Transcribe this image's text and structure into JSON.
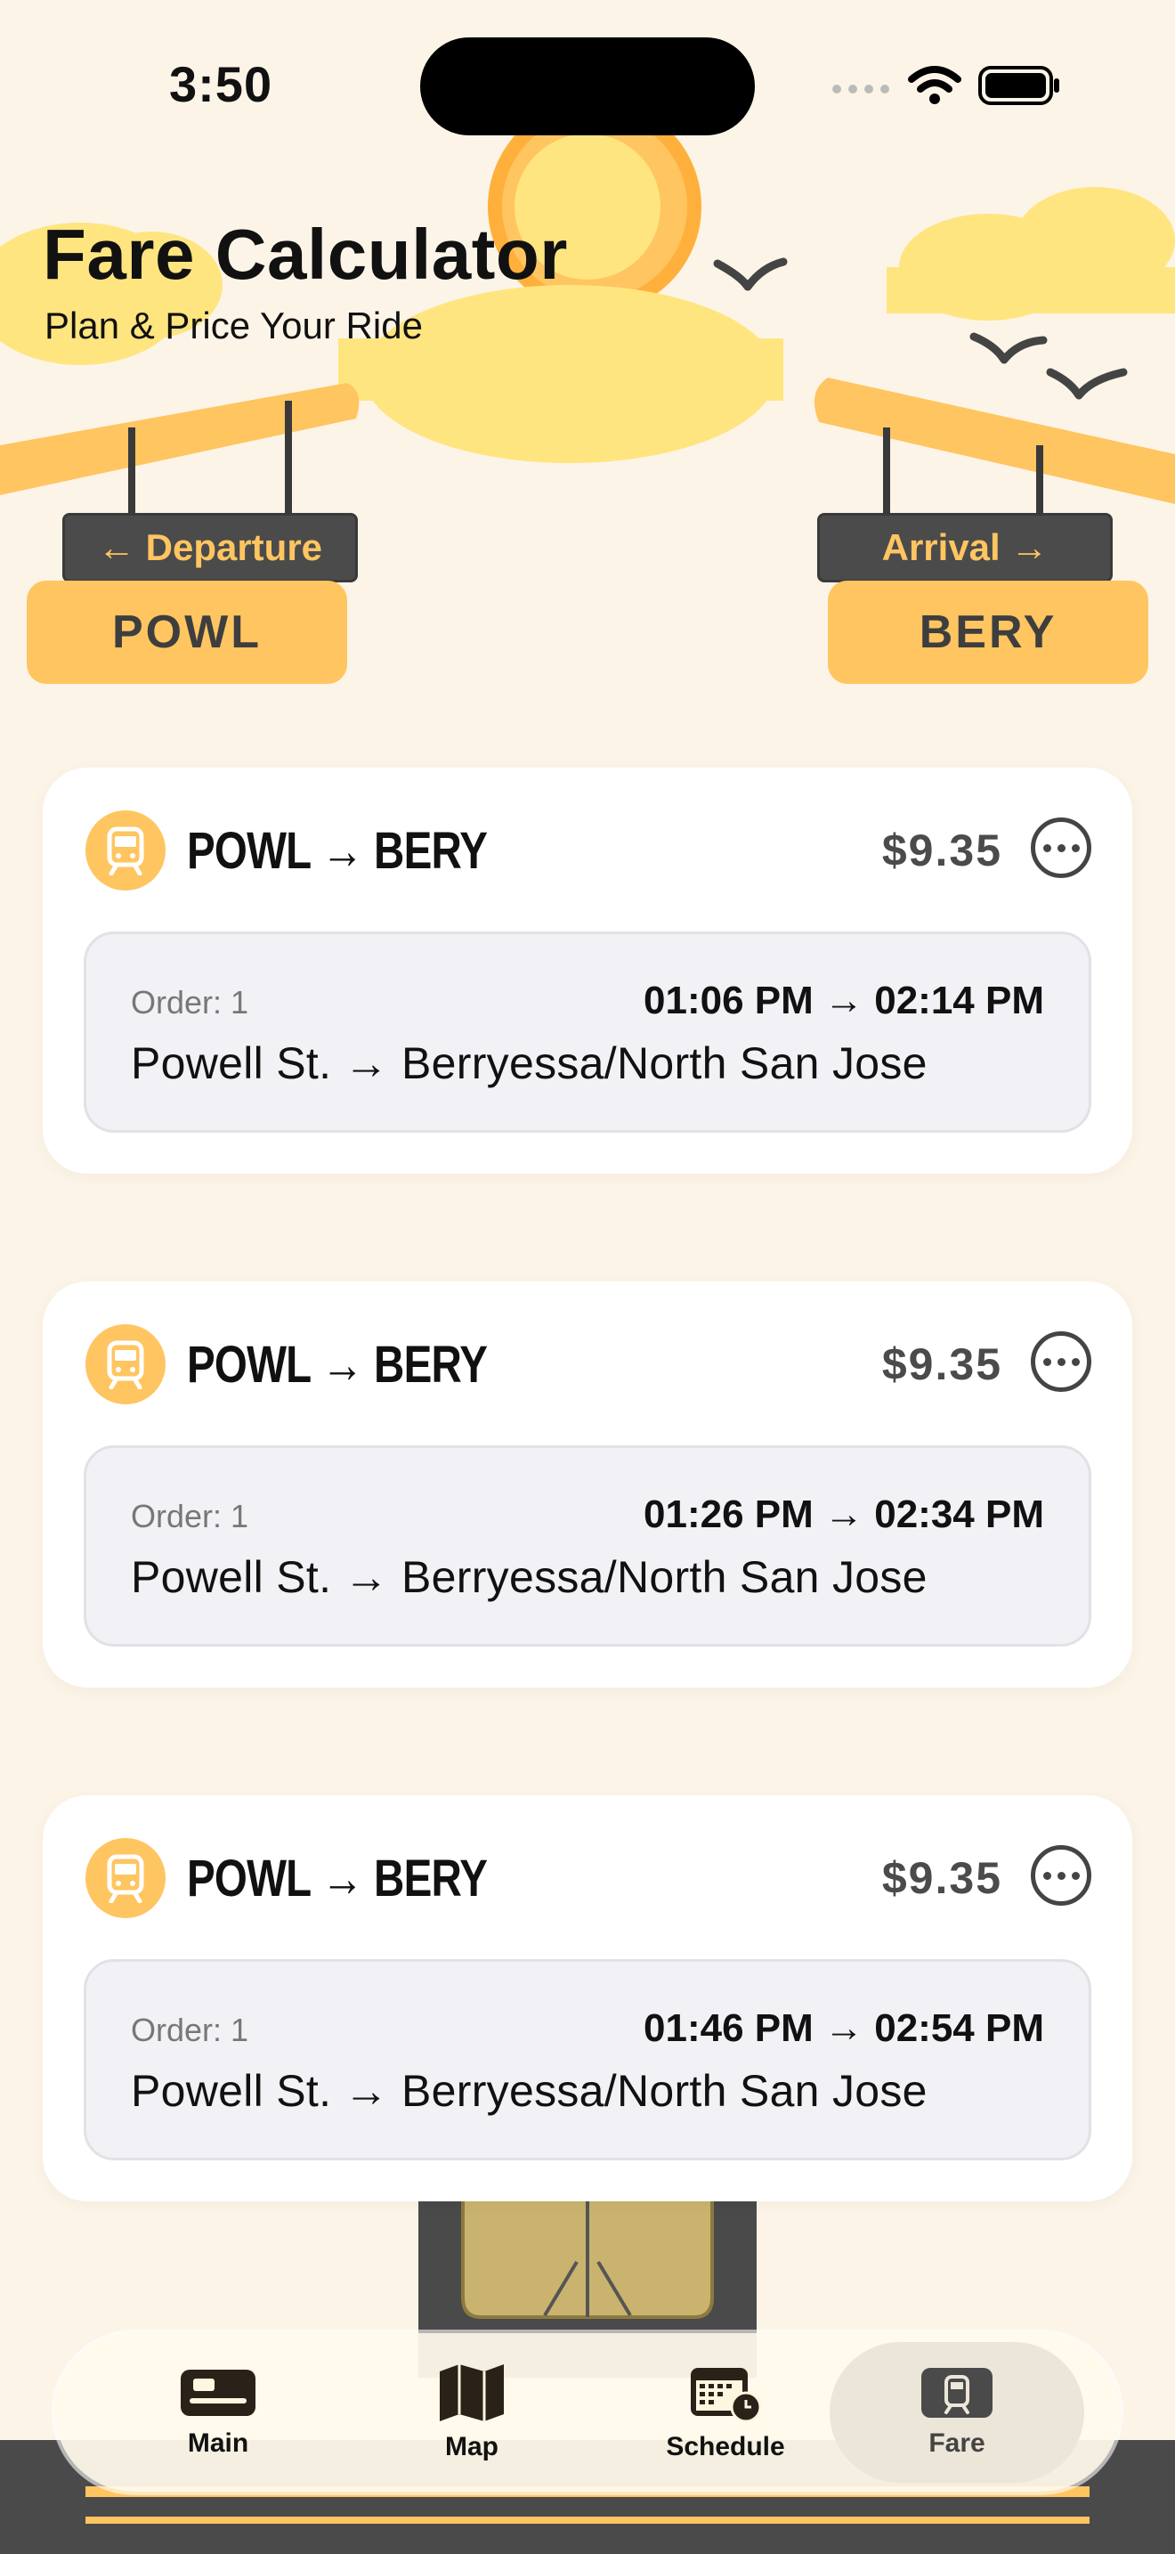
{
  "status_bar": {
    "time": "3:50"
  },
  "header": {
    "title": "Fare Calculator",
    "subtitle": "Plan & Price Your Ride"
  },
  "signs": {
    "departure": {
      "label": "← Departure",
      "station": "POWL"
    },
    "arrival": {
      "label": "Arrival →",
      "station": "BERY"
    }
  },
  "trips": [
    {
      "route": "POWL → BERY",
      "price": "$9.35",
      "order": "Order: 1",
      "times": "01:06 PM → 02:14 PM",
      "stations": "Powell St. → Berryessa/North San Jose"
    },
    {
      "route": "POWL → BERY",
      "price": "$9.35",
      "order": "Order: 1",
      "times": "01:26 PM → 02:34 PM",
      "stations": "Powell St. → Berryessa/North San Jose"
    },
    {
      "route": "POWL → BERY",
      "price": "$9.35",
      "order": "Order: 1",
      "times": "01:46 PM → 02:54 PM",
      "stations": "Powell St. → Berryessa/North San Jose"
    }
  ],
  "tabs": [
    {
      "label": "Main",
      "icon": "train-card-icon"
    },
    {
      "label": "Map",
      "icon": "map-icon"
    },
    {
      "label": "Schedule",
      "icon": "calendar-clock-icon"
    },
    {
      "label": "Fare",
      "icon": "train-icon",
      "active": true
    }
  ],
  "colors": {
    "background": "#FDF4E8",
    "accent": "#FFC561",
    "sign_dark": "#4B4B4B",
    "sun": "#FFE580"
  }
}
